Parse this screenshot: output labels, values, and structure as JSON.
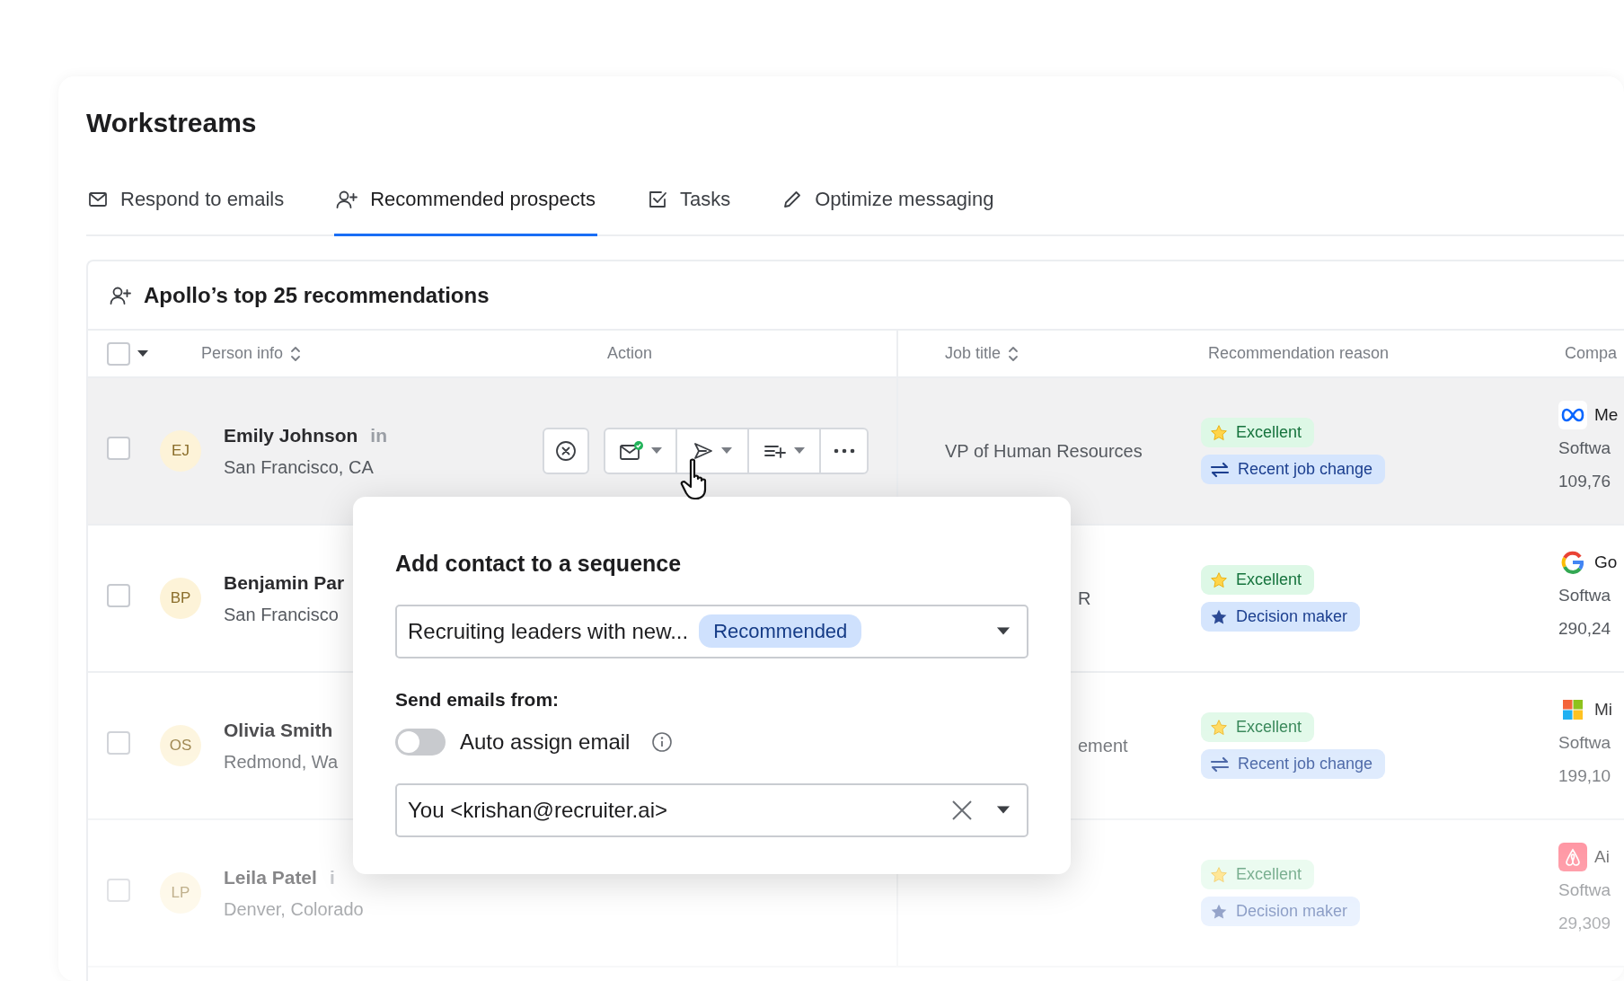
{
  "page": {
    "title": "Workstreams"
  },
  "tabs": [
    {
      "label": "Respond to emails",
      "selected": false
    },
    {
      "label": "Recommended prospects",
      "selected": true
    },
    {
      "label": "Tasks",
      "selected": false
    },
    {
      "label": "Optimize messaging",
      "selected": false
    }
  ],
  "panel": {
    "title": "Apollo’s top 25 recommendations",
    "select_all": {
      "checked": false
    },
    "columns": [
      {
        "label": "Person info",
        "sortable": true
      },
      {
        "label": "Action",
        "sortable": false
      },
      {
        "label": "Job title",
        "sortable": true
      },
      {
        "label": "Recommendation reason",
        "sortable": false
      },
      {
        "label": "Compa",
        "sortable": false
      }
    ],
    "rows": [
      {
        "initials": "EJ",
        "name": "Emily Johnson",
        "social": "in",
        "location": "San Francisco, CA",
        "checked": false,
        "hovered": true,
        "job_title": "VP of Human Resources",
        "reasons": [
          {
            "kind": "excellent",
            "label": "Excellent"
          },
          {
            "kind": "job_change",
            "label": "Recent job change"
          }
        ],
        "company": {
          "name": "Me",
          "industry": "Softwa",
          "employees": "109,76"
        }
      },
      {
        "initials": "BP",
        "name": "Benjamin Par",
        "location": "San Francisco",
        "checked": false,
        "hovered": false,
        "job_title": "R",
        "reasons": [
          {
            "kind": "excellent",
            "label": "Excellent"
          },
          {
            "kind": "decision_maker",
            "label": "Decision maker"
          }
        ],
        "company": {
          "name": "Go",
          "industry": "Softwa",
          "employees": "290,24"
        }
      },
      {
        "initials": "OS",
        "name": "Olivia Smith",
        "location": "Redmond, Wa",
        "checked": false,
        "hovered": false,
        "job_title": "ement",
        "reasons": [
          {
            "kind": "excellent",
            "label": "Excellent"
          },
          {
            "kind": "job_change",
            "label": "Recent job change"
          }
        ],
        "company": {
          "name": "Mi",
          "industry": "Softwa",
          "employees": "199,10"
        }
      },
      {
        "initials": "LP",
        "name": "Leila Patel",
        "social": "i",
        "location": "Denver, Colorado",
        "checked": false,
        "hovered": false,
        "reasons": [
          {
            "kind": "excellent",
            "label": "Excellent"
          },
          {
            "kind": "decision_maker",
            "label": "Decision maker"
          }
        ],
        "company": {
          "name": "Ai",
          "industry": "Softwa",
          "employees": "29,309"
        }
      }
    ]
  },
  "popup": {
    "title": "Add contact to a sequence",
    "sequence": {
      "value": "Recruiting leaders with new...",
      "badge": "Recommended"
    },
    "from_label": "Send emails from:",
    "auto_assign": {
      "label": "Auto assign email",
      "on": false
    },
    "sender": {
      "value": "You <krishan@recruiter.ai>"
    }
  }
}
